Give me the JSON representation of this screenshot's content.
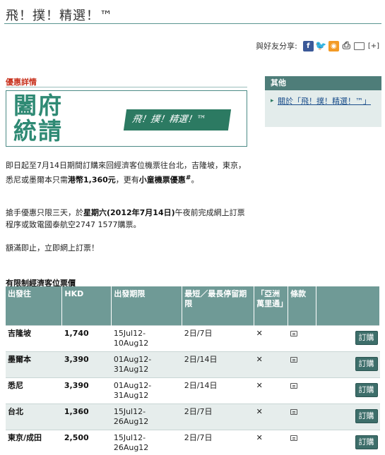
{
  "page": {
    "title": "飛！撲！精選！™"
  },
  "share": {
    "label": "與好友分享:",
    "more": "[+]"
  },
  "offer": {
    "heading": "優惠詳情"
  },
  "banner": {
    "logo_line1": "闔府",
    "logo_line2": "統請",
    "tag_text": "飛！撲！精選！™"
  },
  "body": {
    "p1_a": "即日起至7月14日期間訂購來回經濟客位機票往台北，吉隆坡，東京，悉尼或墨爾本只需",
    "p1_b": "港幣1,360元",
    "p1_c": "，更有",
    "p1_d": "小童機票優惠",
    "p1_e": "#",
    "p1_f": "。",
    "p2_a": "搶手優惠只限三天，於",
    "p2_b": "星期六(2012年7月14日)",
    "p2_c": "午夜前完成網上訂票程序或致電國泰航空2747 1577購票。",
    "p3": "額滿即止，立即網上訂票！"
  },
  "sidebar": {
    "heading": "其他",
    "link": "關於「飛！撲！精選！™」"
  },
  "fares": {
    "title": "有限制經濟客位票價",
    "headers": [
      "出發往",
      "HKD",
      "出發期限",
      "最短／最長停留期限",
      "「亞洲萬里通」",
      "條款",
      ""
    ],
    "book_label": "訂購",
    "rows": [
      {
        "dest": "吉隆坡",
        "price": "1,740",
        "period": "15Jul12-10Aug12",
        "stay": "2日/7日",
        "asia_miles": "✕"
      },
      {
        "dest": "墨爾本",
        "price": "3,390",
        "period": "01Aug12-31Aug12",
        "stay": "2日/14日",
        "asia_miles": "✕"
      },
      {
        "dest": "悉尼",
        "price": "3,390",
        "period": "01Aug12-31Aug12",
        "stay": "2日/14日",
        "asia_miles": "✕"
      },
      {
        "dest": "台北",
        "price": "1,360",
        "period": "15Jul12-26Aug12",
        "stay": "2日/7日",
        "asia_miles": "✕"
      },
      {
        "dest": "東京/成田",
        "price": "2,500",
        "period": "15Jul12-26Aug12",
        "stay": "2日/7日",
        "asia_miles": "✕"
      }
    ]
  },
  "colors": {
    "accent": "#4e7d79",
    "heading_red": "#c8321e",
    "brand_green": "#2c7a62"
  }
}
